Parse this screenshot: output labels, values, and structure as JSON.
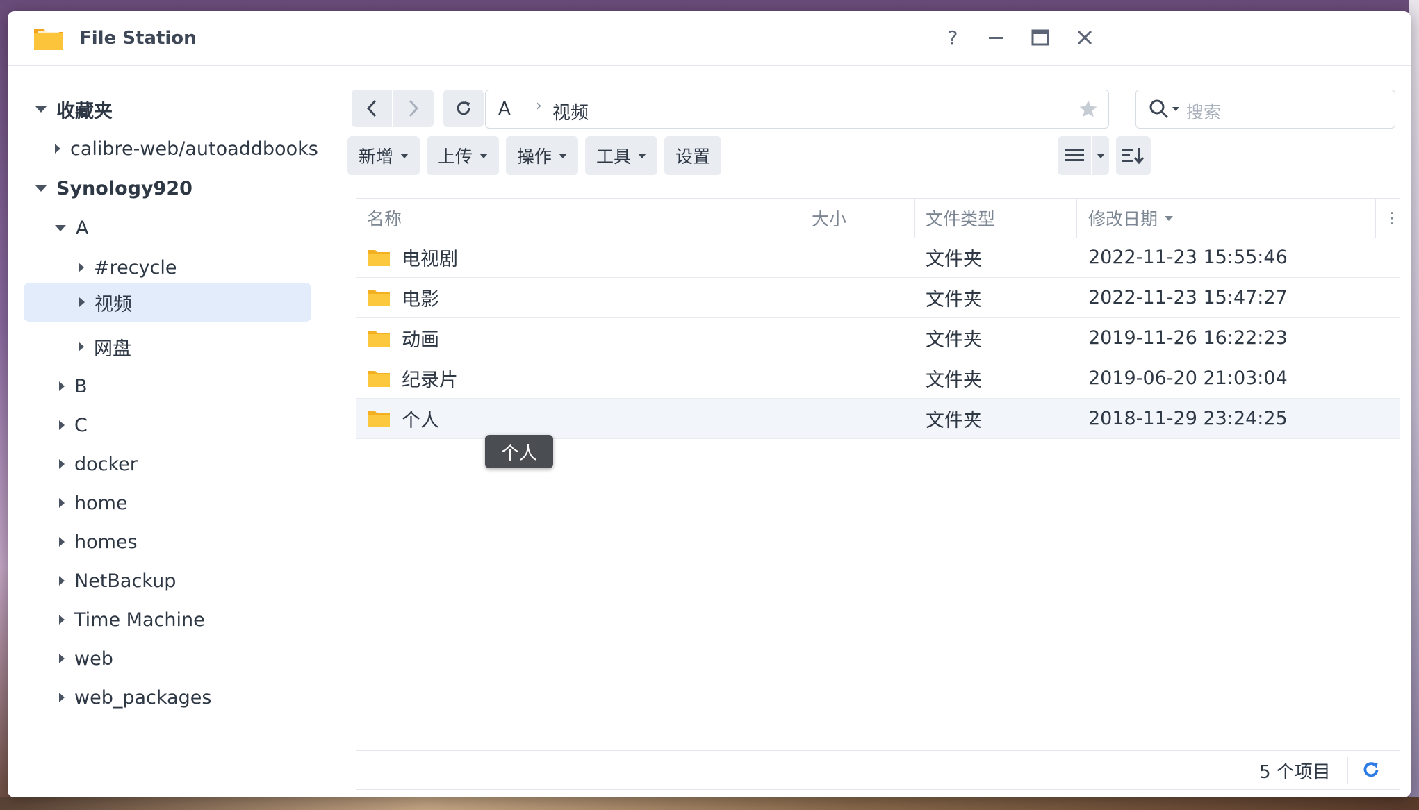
{
  "window": {
    "title": "File Station",
    "help": "?"
  },
  "sidebar": {
    "favorites_label": "收藏夹",
    "favorites_items": [
      "calibre-web/autoaddbooks"
    ],
    "server_label": "Synology920",
    "folders": [
      {
        "label": "A",
        "expanded": true
      },
      {
        "label": "#recycle"
      },
      {
        "label": "视频",
        "selected": true
      },
      {
        "label": "网盘"
      },
      {
        "label": "B"
      },
      {
        "label": "C"
      },
      {
        "label": "docker"
      },
      {
        "label": "home"
      },
      {
        "label": "homes"
      },
      {
        "label": "NetBackup"
      },
      {
        "label": "Time Machine"
      },
      {
        "label": "web"
      },
      {
        "label": "web_packages"
      }
    ]
  },
  "path": {
    "root": "A",
    "current": "视频"
  },
  "search": {
    "placeholder": "搜索"
  },
  "toolbar": {
    "new": "新增",
    "upload": "上传",
    "action": "操作",
    "tools": "工具",
    "settings": "设置"
  },
  "table": {
    "columns": [
      "名称",
      "大小",
      "文件类型",
      "修改日期"
    ],
    "rows": [
      {
        "name": "电视剧",
        "size": "",
        "type": "文件夹",
        "modified": "2022-11-23 15:55:46"
      },
      {
        "name": "电影",
        "size": "",
        "type": "文件夹",
        "modified": "2022-11-23 15:47:27"
      },
      {
        "name": "动画",
        "size": "",
        "type": "文件夹",
        "modified": "2019-11-26 16:22:23"
      },
      {
        "name": "纪录片",
        "size": "",
        "type": "文件夹",
        "modified": "2019-06-20 21:03:04"
      },
      {
        "name": "个人",
        "size": "",
        "type": "文件夹",
        "modified": "2018-11-29 23:24:25"
      }
    ]
  },
  "tooltip": "个人",
  "footer": {
    "count": "5 个项目"
  },
  "colors": {
    "accent": "#2d7be5",
    "folder": "#f7c23d",
    "selected": "#e3ecfb"
  }
}
